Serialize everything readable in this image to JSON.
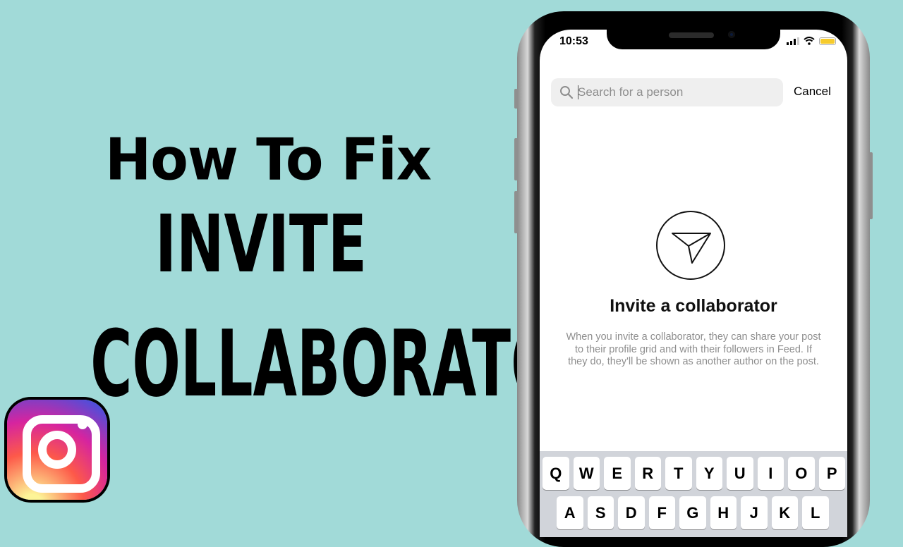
{
  "thumbnail": {
    "line1": "How To Fix",
    "line2": "INVITE",
    "line3": "COLLABORATOR",
    "logo": "instagram-logo",
    "background_color": "#a1dad8"
  },
  "phone": {
    "status_bar": {
      "time": "10:53",
      "icons": [
        "cellular-signal-icon",
        "wifi-icon",
        "battery-icon"
      ],
      "battery_color": "#f6cb2c"
    },
    "search": {
      "placeholder": "Search for a person",
      "value": "",
      "cancel_label": "Cancel"
    },
    "empty_state": {
      "icon": "send-icon",
      "title": "Invite a collaborator",
      "description": "When you invite a collaborator, they can share your post to their profile grid and with their followers in Feed. If they do, they'll be shown as another author on the post."
    },
    "keyboard": {
      "row1": [
        "Q",
        "W",
        "E",
        "R",
        "T",
        "Y",
        "U",
        "I",
        "O",
        "P"
      ],
      "row2": [
        "A",
        "S",
        "D",
        "F",
        "G",
        "H",
        "J",
        "K",
        "L"
      ]
    }
  }
}
